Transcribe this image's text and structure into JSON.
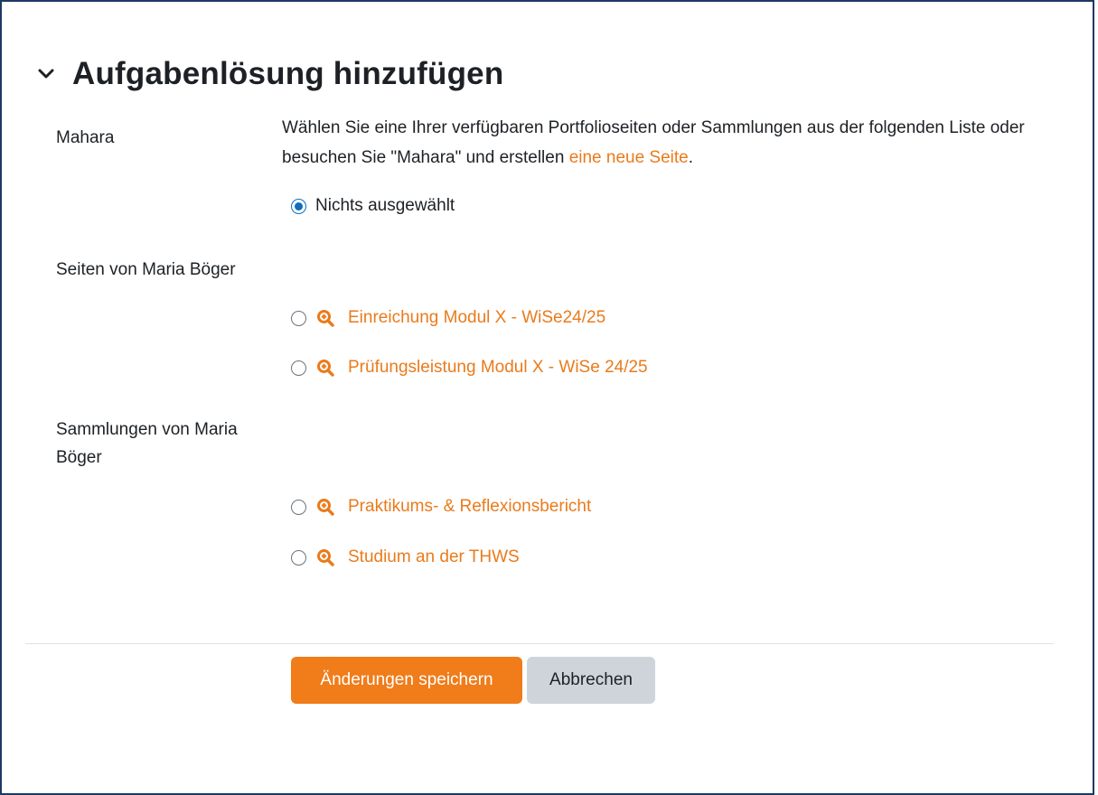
{
  "section": {
    "title": "Aufgabenlösung hinzufügen",
    "collapse_icon": "chevron-down-icon"
  },
  "mahara": {
    "label": "Mahara",
    "description_prefix": "Wählen Sie eine Ihrer verfügbaren Portfolioseiten oder Sammlungen aus der folgenden Liste oder besuchen Sie \"Mahara\" und erstellen ",
    "description_link": "eine neue Seite",
    "description_suffix": ".",
    "none_option": {
      "label": "Nichts ausgewählt",
      "selected": true
    }
  },
  "pages": {
    "label": "Seiten von Maria Böger",
    "items": [
      {
        "label": "Einreichung Modul X - WiSe24/25",
        "icon": "zoom-in-icon",
        "selected": false
      },
      {
        "label": "Prüfungsleistung Modul X - WiSe 24/25",
        "icon": "zoom-in-icon",
        "selected": false
      }
    ]
  },
  "collections": {
    "label_line1": "Sammlungen von Maria",
    "label_line2": "Böger",
    "items": [
      {
        "label": "Praktikums- & Reflexionsbericht",
        "icon": "zoom-in-icon",
        "selected": false
      },
      {
        "label": "Studium an der THWS",
        "icon": "zoom-in-icon",
        "selected": false
      }
    ]
  },
  "buttons": {
    "save": "Änderungen speichern",
    "cancel": "Abbrechen"
  },
  "colors": {
    "accent": "#f07c1a",
    "link": "#e97b1c",
    "radio_selected": "#0f6cbf",
    "frame_border": "#1f3864",
    "secondary_button": "#ced4da"
  }
}
